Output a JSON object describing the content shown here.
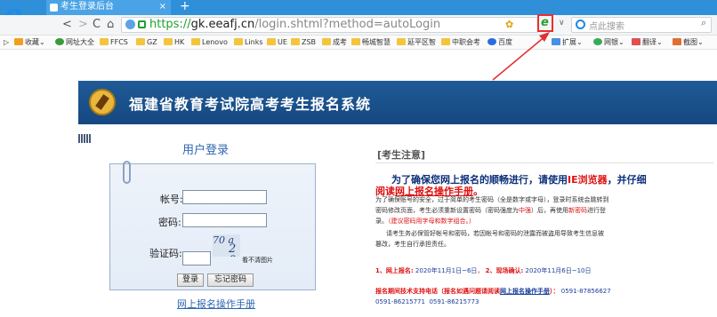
{
  "browser": {
    "tab_title": "考生登录后台",
    "tab_close": "×",
    "new_tab": "+",
    "nav": {
      "back": "<",
      "forward": ">",
      "reload": "C",
      "home": "⌂"
    },
    "url": {
      "scheme": "https://",
      "sub": "gk.",
      "domain": "eeafj.cn",
      "path": "/login.shtml?method=autoLogin"
    },
    "search_placeholder": "点此搜索",
    "bookmarks": [
      "收藏",
      "网址大全",
      "FFCS",
      "GZ",
      "HK",
      "Lenovo",
      "Links",
      "UE",
      "ZSB",
      "成考",
      "畅城智慧",
      "延平区智",
      "中职会考",
      "百度",
      "扩展",
      "网银",
      "翻译",
      "截图"
    ]
  },
  "banner": {
    "title": "福建省教育考试院高考考生报名系统"
  },
  "login": {
    "title": "用户登录",
    "account_label": "帐号:",
    "password_label": "密码:",
    "captcha_label": "验证码:",
    "captcha_text_top": "70 a",
    "captcha_text_bottom": "2 8",
    "captcha_unclear": "看不清图片",
    "login_button": "登录",
    "forgot_button": "忘记密码",
    "manual_link": "网上报名操作手册"
  },
  "notice": {
    "heading": "[考生注意]",
    "line1_a": "为了确保您网上报名的顺畅进行，请使用",
    "line1_red": "IE浏览器",
    "line1_b": "，并仔细",
    "line2_a": "阅读",
    "line2_link": "网上报名操作手册",
    "line2_b": "。",
    "p1_l1": "为了确保账号的安全，过于简单的考生密码（全是数字或字母），登录时系统会跳转到",
    "p1_l2a": "密码修改页面，考生必须重新设置密码（密码强度为",
    "p1_l2_red1": "中强",
    "p1_l2b": "）后，再使用",
    "p1_l2_red2": "新密码",
    "p1_l2c": "进行登",
    "p1_l3a": "录。",
    "p1_l3_red": "（建议密码用字母和数字组合。）",
    "p2_l1": "请考生务必保管好帐号和密码，若因帐号和密码的泄露而被盗用导致考生信息被",
    "p2_l2": "篡改，考生自行承担责任。",
    "dates_a": "1、网上报名:",
    "dates_b": "2020年11月1日~6日",
    "dates_c": "2、现场确认:",
    "dates_d": "2020年11月6日~10日",
    "support_a": "报名期间技术支持电话（报名如遇问题请阅读",
    "support_link": "网上报名操作手册",
    "support_b": "）：",
    "phone1": "0591-87856627",
    "phone2": "0591-86215771",
    "phone3": "0591-86215773"
  }
}
